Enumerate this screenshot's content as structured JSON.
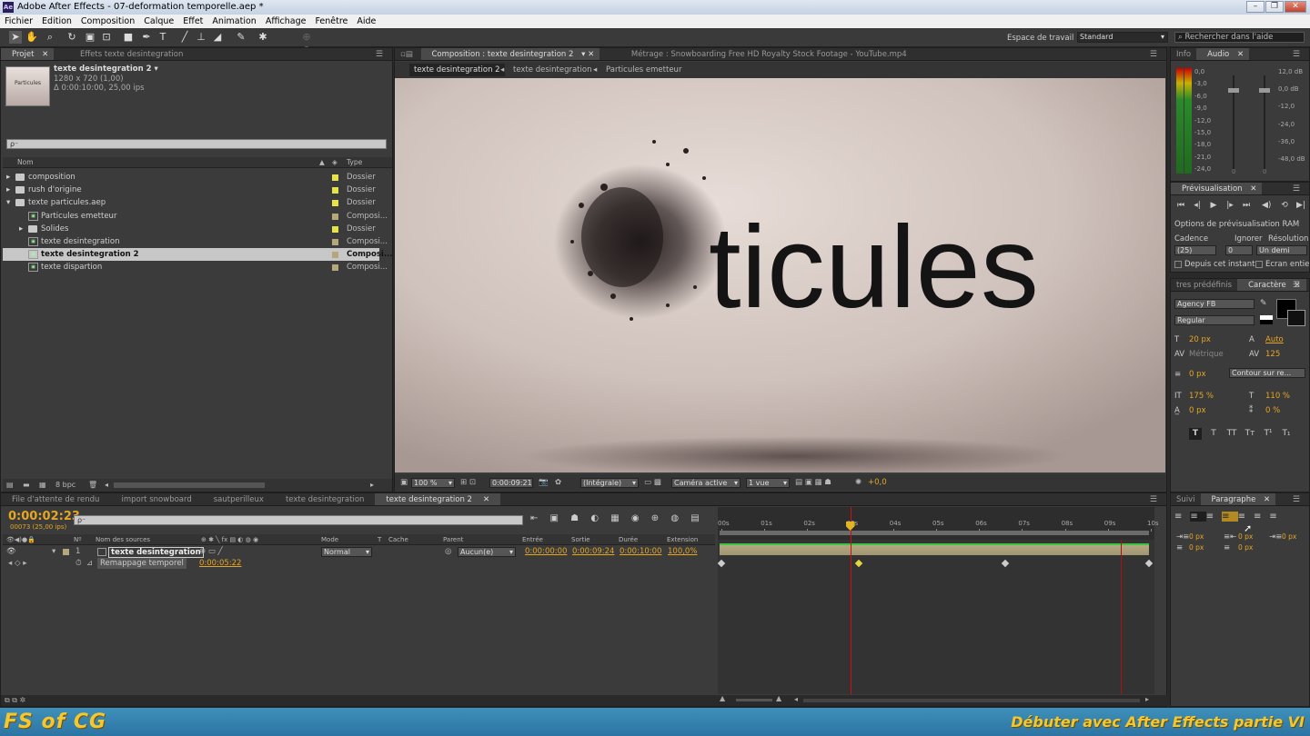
{
  "window": {
    "title": "Adobe After Effects - 07-deformation temporelle.aep *",
    "app_icon": "Ae"
  },
  "menu": [
    "Fichier",
    "Edition",
    "Composition",
    "Calque",
    "Effet",
    "Animation",
    "Affichage",
    "Fenêtre",
    "Aide"
  ],
  "toolbar": {
    "workspace_label": "Espace de travail :",
    "workspace_value": "Standard",
    "help_placeholder": "Rechercher dans l'aide"
  },
  "project": {
    "tabs": [
      "Projet",
      "Effets texte desintegration"
    ],
    "comp_name": "texte desintegration 2 ▾",
    "comp_size": "1280 x 720 (1,00)",
    "comp_duration": "Δ 0:00:10:00, 25,00 ips",
    "thumb_text": "Particules",
    "search_value": "ρ⁻",
    "col_name": "Nom",
    "col_type": "Type",
    "items": [
      {
        "name": "composition",
        "type": "Dossier",
        "kind": "folder",
        "color": "#e8e24a",
        "expanded": false,
        "depth": 0
      },
      {
        "name": "rush d'origine",
        "type": "Dossier",
        "kind": "folder",
        "color": "#e8e24a",
        "expanded": false,
        "depth": 0
      },
      {
        "name": "texte particules.aep",
        "type": "Dossier",
        "kind": "folder",
        "color": "#e8e24a",
        "expanded": true,
        "depth": 0
      },
      {
        "name": "Particules emetteur",
        "type": "Composi...",
        "kind": "comp",
        "color": "#b6a77a",
        "depth": 1
      },
      {
        "name": "Solides",
        "type": "Dossier",
        "kind": "folder",
        "color": "#e8e24a",
        "expanded": false,
        "depth": 1
      },
      {
        "name": "texte desintegration",
        "type": "Composi...",
        "kind": "comp",
        "color": "#b6a77a",
        "depth": 1
      },
      {
        "name": "texte desintegration 2",
        "type": "Composi...",
        "kind": "comp",
        "color": "#b6a77a",
        "depth": 1,
        "selected": true
      },
      {
        "name": "texte dispartion",
        "type": "Composi...",
        "kind": "comp",
        "color": "#b6a77a",
        "depth": 1
      }
    ],
    "footer_bpc": "8 bpc"
  },
  "comp": {
    "tabs": [
      "Composition : texte desintegration 2",
      "Métrage : Snowboarding Free HD Royalty Stock Footage - YouTube.mp4"
    ],
    "breadcrumbs": [
      "texte desintegration 2",
      "texte desintegration",
      "Particules emetteur"
    ],
    "text": "ticules",
    "zoom": "100 %",
    "timecode": "0:00:09:21",
    "resolution": "(Intégrale)",
    "camera": "Caméra active",
    "views": "1 vue",
    "exposure": "+0,0"
  },
  "info": {
    "tabs": [
      "Info",
      "Audio"
    ],
    "db_left": [
      "0,0",
      "-3,0",
      "-6,0",
      "-9,0",
      "-12,0",
      "-15,0",
      "-18,0",
      "-21,0",
      "-24,0"
    ],
    "db_right": [
      "12,0 dB",
      "0,0 dB",
      "-12,0",
      "-24,0",
      "-36,0",
      "-48,0 dB"
    ],
    "slider_labels": [
      "0",
      "0"
    ]
  },
  "preview": {
    "tab": "Prévisualisation",
    "options": "Options de prévisualisation RAM",
    "cadence_label": "Cadence",
    "ignorer_label": "Ignorer",
    "resolution_label": "Résolution",
    "cadence": "(25)",
    "ignorer": "0",
    "resolution": "Un demi",
    "check1": "Depuis cet instant",
    "check2": "Ecran entier"
  },
  "character": {
    "tabs": [
      "tres prédéfinis",
      "Caractère"
    ],
    "font": "Agency FB",
    "style": "Regular",
    "size": "20 px",
    "leading": "Auto",
    "kerning": "Métrique",
    "tracking": "125",
    "stroke_w": "0 px",
    "stroke_type": "Contour sur re...",
    "vscale": "175 %",
    "hscale": "110 %",
    "baseline": "0 px",
    "tsume": "0 %",
    "styles": [
      "T",
      "T",
      "TT",
      "Tт",
      "T¹",
      "T₁"
    ]
  },
  "timeline": {
    "tabs": [
      "File d'attente de rendu",
      "import snowboard",
      "sautperilleux",
      "texte desintegration",
      "texte desintegration 2"
    ],
    "timecode": "0:00:02:23",
    "frames": "00073 (25,00 ips)",
    "search": "ρ⁻",
    "cols": [
      "Nº",
      "Nom des sources",
      "Mode",
      "T",
      "Cache",
      "Parent",
      "Entrée",
      "Sortie",
      "Durée",
      "Extension"
    ],
    "layer": {
      "num": "1",
      "name": "texte desintegration",
      "mode": "Normal",
      "parent": "Aucun(e)",
      "in": "0:00:00:00",
      "out": "0:00:09:24",
      "dur": "0:00:10:00",
      "stretch": "100,0%"
    },
    "prop": {
      "name": "Remappage temporel",
      "value": "0:00:05:22"
    },
    "ruler": [
      "00s",
      "01s",
      "02s",
      "03s",
      "04s",
      "05s",
      "06s",
      "07s",
      "08s",
      "09s",
      "10s"
    ],
    "current_fraction": 0.3,
    "end_fraction": 0.93
  },
  "paragraph": {
    "tabs": [
      "Suivi",
      "Paragraphe"
    ],
    "indent_values": [
      "0 px",
      "0 px",
      "0 px",
      "0 px",
      "0 px"
    ]
  },
  "branding": {
    "logo": "FS of CG",
    "course": "Débuter avec After Effects partie VI"
  }
}
